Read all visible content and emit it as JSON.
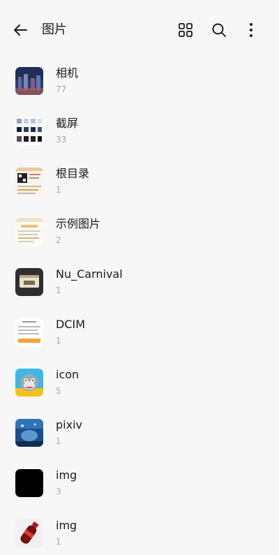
{
  "header": {
    "title": "图片",
    "icons": [
      "back-arrow-icon",
      "grid-view-icon",
      "search-icon",
      "more-vertical-icon"
    ]
  },
  "albums": [
    {
      "name": "相机",
      "count": "77"
    },
    {
      "name": "截屏",
      "count": "33"
    },
    {
      "name": "根目录",
      "count": "1"
    },
    {
      "name": "示例图片",
      "count": "2"
    },
    {
      "name": "Nu_Carnival",
      "count": "1"
    },
    {
      "name": "DCIM",
      "count": "1"
    },
    {
      "name": "icon",
      "count": "5"
    },
    {
      "name": "pixiv",
      "count": "1"
    },
    {
      "name": "img",
      "count": "3"
    },
    {
      "name": "img",
      "count": "1"
    }
  ]
}
